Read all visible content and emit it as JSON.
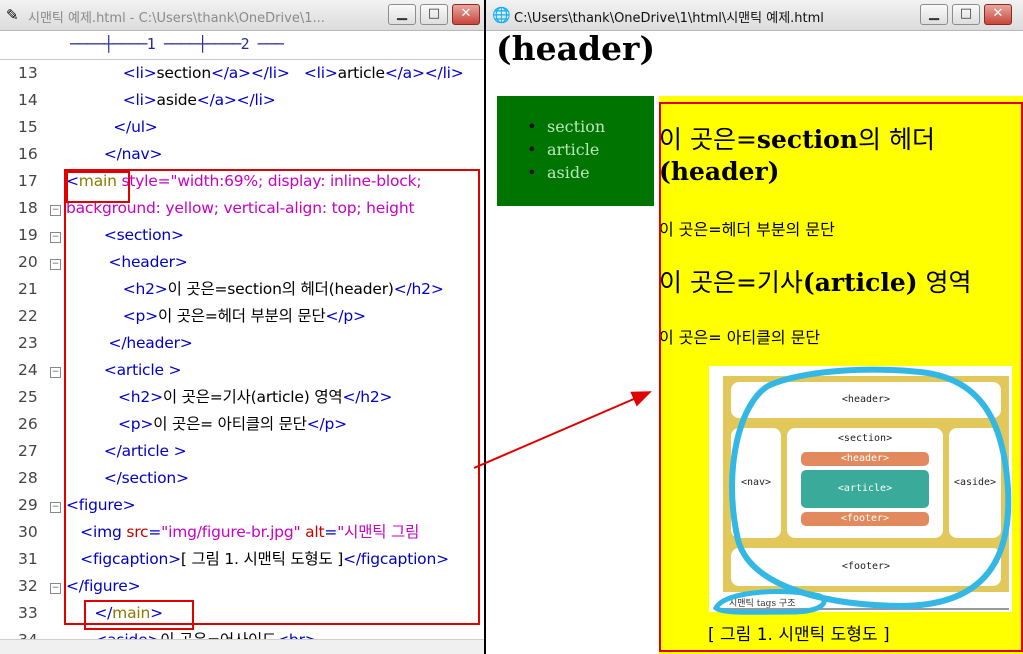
{
  "left_window": {
    "title": "시맨틱 예제.html - C:\\Users\\thank\\OneDrive\\1...",
    "ruler": "────┼────1 ────┼────2 ───",
    "lines": [
      {
        "n": "13",
        "segments": [
          {
            "c": "t",
            "v": "            <li>"
          },
          {
            "c": "tx",
            "v": "section"
          },
          {
            "c": "t",
            "v": "</a></li>   <li>"
          },
          {
            "c": "tx",
            "v": "article"
          },
          {
            "c": "t",
            "v": "</a></li>"
          }
        ]
      },
      {
        "n": "14",
        "segments": [
          {
            "c": "t",
            "v": "            <li>"
          },
          {
            "c": "tx",
            "v": "aside"
          },
          {
            "c": "t",
            "v": "</a></li>"
          }
        ]
      },
      {
        "n": "15",
        "segments": [
          {
            "c": "t",
            "v": "          </ul>"
          }
        ]
      },
      {
        "n": "16",
        "segments": [
          {
            "c": "t",
            "v": "        </nav>"
          }
        ]
      },
      {
        "n": "17",
        "segments": [
          {
            "c": "t",
            "v": "<"
          },
          {
            "c": "mn",
            "v": "main"
          },
          {
            "c": "av",
            "v": " style=\"width:69%; display: inline-block;"
          }
        ]
      },
      {
        "n": "18",
        "segments": [
          {
            "c": "av",
            "v": "background: yellow; vertical-align: top; height"
          }
        ]
      },
      {
        "n": "19",
        "segments": [
          {
            "c": "t",
            "v": "        <section>"
          }
        ]
      },
      {
        "n": "20",
        "segments": [
          {
            "c": "t",
            "v": "         <header>"
          }
        ]
      },
      {
        "n": "21",
        "segments": [
          {
            "c": "t",
            "v": "            <h2>"
          },
          {
            "c": "tx",
            "v": "이 곳은=section의 헤더(header)"
          },
          {
            "c": "t",
            "v": "</h2>"
          }
        ]
      },
      {
        "n": "22",
        "segments": [
          {
            "c": "t",
            "v": "            <p>"
          },
          {
            "c": "tx",
            "v": "이 곳은=헤더 부분의 문단"
          },
          {
            "c": "t",
            "v": "</p>"
          }
        ]
      },
      {
        "n": "23",
        "segments": [
          {
            "c": "t",
            "v": "         </header>"
          }
        ]
      },
      {
        "n": "24",
        "segments": [
          {
            "c": "t",
            "v": "        <article >"
          }
        ]
      },
      {
        "n": "25",
        "segments": [
          {
            "c": "t",
            "v": "           <h2>"
          },
          {
            "c": "tx",
            "v": "이 곳은=기사(article) 영역"
          },
          {
            "c": "t",
            "v": "</h2>"
          }
        ]
      },
      {
        "n": "26",
        "segments": [
          {
            "c": "t",
            "v": "           <p>"
          },
          {
            "c": "tx",
            "v": "이 곳은= 아티클의 문단"
          },
          {
            "c": "t",
            "v": "</p>"
          }
        ]
      },
      {
        "n": "27",
        "segments": [
          {
            "c": "t",
            "v": "        </article >"
          }
        ]
      },
      {
        "n": "28",
        "segments": [
          {
            "c": "t",
            "v": "        </section>"
          }
        ]
      },
      {
        "n": "29",
        "segments": [
          {
            "c": "t",
            "v": "<figure>"
          }
        ]
      },
      {
        "n": "30",
        "segments": [
          {
            "c": "t",
            "v": "   <img "
          },
          {
            "c": "at",
            "v": "src"
          },
          {
            "c": "t",
            "v": "="
          },
          {
            "c": "av",
            "v": "\"img/figure-br.jpg\""
          },
          {
            "c": "at",
            "v": " alt"
          },
          {
            "c": "t",
            "v": "="
          },
          {
            "c": "av",
            "v": "\"시맨틱 그림"
          }
        ]
      },
      {
        "n": "31",
        "segments": [
          {
            "c": "t",
            "v": "   <figcaption>"
          },
          {
            "c": "tx",
            "v": "[ 그림 1. 시맨틱 도형도 ]"
          },
          {
            "c": "t",
            "v": "</figcaption>"
          }
        ]
      },
      {
        "n": "32",
        "segments": [
          {
            "c": "t",
            "v": "</figure>"
          }
        ]
      },
      {
        "n": "33",
        "segments": [
          {
            "c": "t",
            "v": "      </"
          },
          {
            "c": "mn",
            "v": "main"
          },
          {
            "c": "t",
            "v": ">"
          }
        ]
      },
      {
        "n": "34",
        "segments": [
          {
            "c": "t",
            "v": "      <aside>"
          },
          {
            "c": "tx",
            "v": "이 곳은=어사이드"
          },
          {
            "c": "t",
            "v": "<br>"
          }
        ]
      }
    ],
    "fold_lines": [
      "18",
      "19",
      "20",
      "24",
      "29",
      "32"
    ]
  },
  "right_window": {
    "title": "C:\\Users\\thank\\OneDrive\\1\\html\\시맨틱 예제.html",
    "top_heading": "(header)",
    "nav_items": [
      "section",
      "article",
      "aside"
    ],
    "section_heading_kr": "이 곳은=",
    "section_heading_en": "section",
    "section_heading_kr2": "의 헤더",
    "section_heading_line2": "(header)",
    "header_paragraph": "이 곳은=헤더 부분의 문단",
    "article_heading_kr": "이 곳은=기사",
    "article_heading_en": "(article)",
    "article_heading_kr2": " 영역",
    "article_paragraph": "이 곳은= 아티클의 문단",
    "figure": {
      "header": "<header>",
      "nav": "<nav>",
      "section": "<section>",
      "inner_header": "<header>",
      "article": "<article>",
      "inner_footer": "<footer>",
      "aside": "<aside>",
      "footer": "<footer>",
      "label": "시맨틱 tags 구조"
    },
    "figcaption": "[ 그림 1. 시맨틱 도형도 ]"
  },
  "colors": {
    "main_bg": "#ffff00",
    "nav_bg": "#007400",
    "highlight": "#e00000",
    "annotation": "#33b8e6"
  }
}
